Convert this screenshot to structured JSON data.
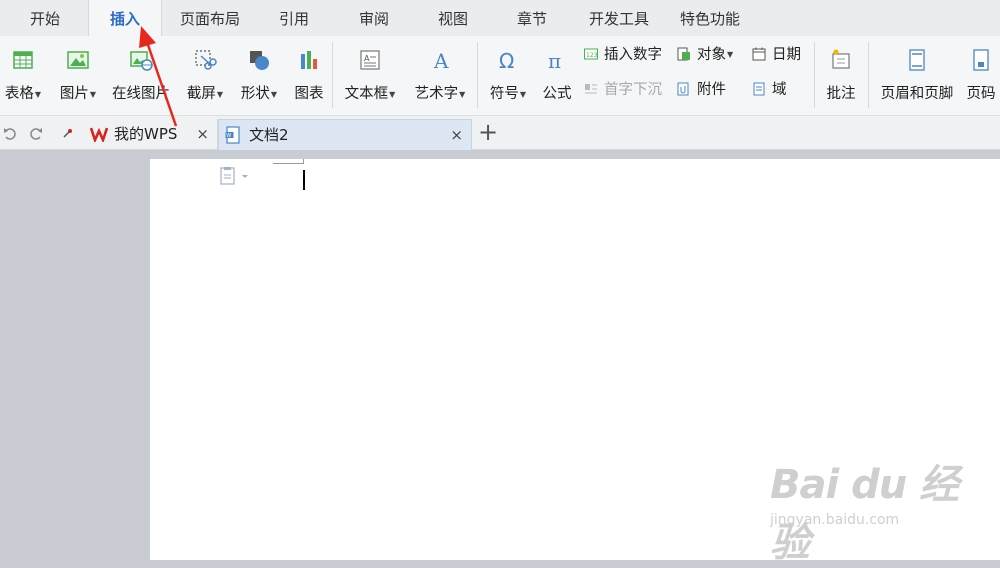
{
  "menu_tabs": [
    "开始",
    "插入",
    "页面布局",
    "引用",
    "审阅",
    "视图",
    "章节",
    "开发工具",
    "特色功能"
  ],
  "active_menu_tab": "插入",
  "ribbon": {
    "table": "表格",
    "picture": "图片",
    "online_picture": "在线图片",
    "screenshot": "截屏",
    "shape": "形状",
    "chart": "图表",
    "textbox": "文本框",
    "wordart": "艺术字",
    "symbol": "符号",
    "formula": "公式",
    "insert_number": "插入数字",
    "drop_cap": "首字下沉",
    "object": "对象",
    "attachment": "附件",
    "date": "日期",
    "field": "域",
    "comment": "批注",
    "header_footer": "页眉和页脚",
    "page_number": "页码"
  },
  "doc_tabs": {
    "my_wps": "我的WPS",
    "doc2": "文档2",
    "close": "×",
    "new": "+"
  },
  "watermark": {
    "logo": "Bai du 经验",
    "sub": "jingyan.baidu.com"
  },
  "colors": {
    "accent": "#2b6cc4",
    "wps_red": "#d9231d",
    "annotation_red": "#e8281f",
    "icon_blue": "#4a86c8",
    "icon_green": "#4caf50"
  }
}
